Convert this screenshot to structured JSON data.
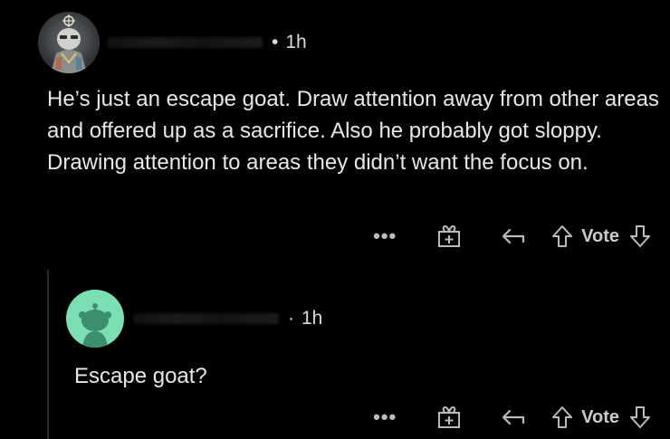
{
  "theme": {
    "background": "#000000",
    "text": "#e6e7e8",
    "muted": "#b8bcbf",
    "reply_avatar_color": "#7ae0b4"
  },
  "comments": [
    {
      "timestamp": "1h",
      "separator": "•",
      "body": "He’s just an escape goat. Draw attention away from other areas and offered up as a sacrifice. Also he probably got sloppy. Drawing attention to areas they didn’t want the focus on.",
      "actions": {
        "more_label": "•••",
        "award_icon": "gift-icon",
        "reply_icon": "reply-arrow-icon",
        "upvote_icon": "arrow-up-icon",
        "vote_label": "Vote",
        "downvote_icon": "arrow-down-icon"
      }
    },
    {
      "timestamp": "1h",
      "separator": "·",
      "body": "Escape goat?",
      "actions": {
        "more_label": "•••",
        "award_icon": "gift-icon",
        "reply_icon": "reply-arrow-icon",
        "upvote_icon": "arrow-up-icon",
        "vote_label": "Vote",
        "downvote_icon": "arrow-down-icon"
      }
    }
  ]
}
